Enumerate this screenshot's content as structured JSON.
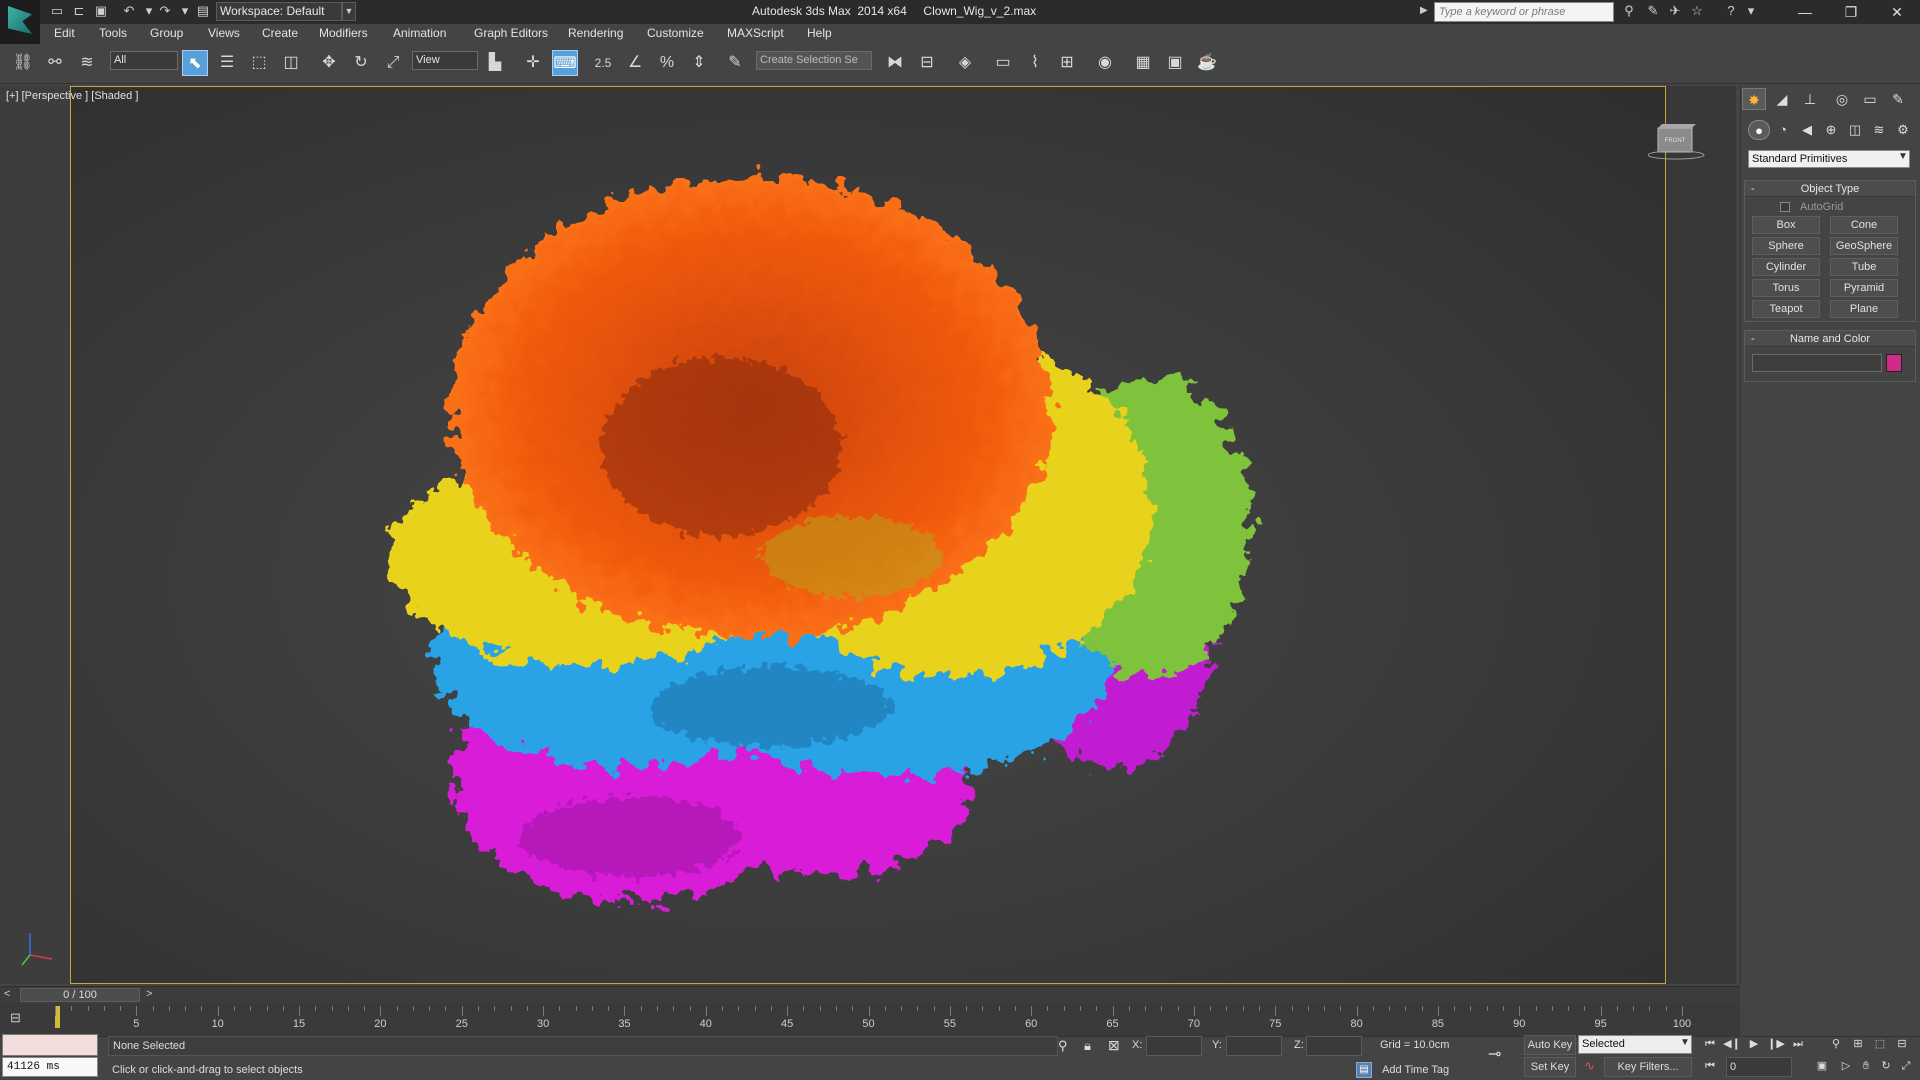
{
  "titlebar": {
    "workspace": "Workspace: Default",
    "app_title": "Autodesk 3ds Max  2014 x64     Clown_Wig_v_2.max",
    "search_placeholder": "Type a keyword or phrase"
  },
  "menu": [
    "Edit",
    "Tools",
    "Group",
    "Views",
    "Create",
    "Modifiers",
    "Animation",
    "Graph Editors",
    "Rendering",
    "Customize",
    "MAXScript",
    "Help"
  ],
  "toolbar": {
    "selection_filter": "All",
    "ref_coord_system": "View",
    "snap_angle_label": "2.5",
    "named_selection_placeholder": "Create Selection Se"
  },
  "viewport": {
    "label": "[+] [Perspective ] [Shaded ]",
    "viewcube_label": "FRONT",
    "hair_colors": [
      "#f05a0a",
      "#e8d21c",
      "#7fc23a",
      "#2aa2e6",
      "#d81fd8"
    ]
  },
  "command_panel": {
    "category": "Standard Primitives",
    "object_type_title": "Object Type",
    "autogrid_label": "AutoGrid",
    "primitives": [
      "Box",
      "Cone",
      "Sphere",
      "GeoSphere",
      "Cylinder",
      "Tube",
      "Torus",
      "Pyramid",
      "Teapot",
      "Plane"
    ],
    "name_color_title": "Name and Color",
    "object_color": "#d02a8a"
  },
  "timeline": {
    "position": "0 / 100",
    "ticks": [
      "5",
      "10",
      "15",
      "20",
      "25",
      "30",
      "35",
      "40",
      "45",
      "50",
      "55",
      "60",
      "65",
      "70",
      "75",
      "80",
      "85",
      "90",
      "95",
      "100"
    ]
  },
  "status": {
    "timing": "41126 ms",
    "selection": "None Selected",
    "prompt": "Click or click-and-drag to select objects",
    "x_label": "X:",
    "y_label": "Y:",
    "z_label": "Z:",
    "grid": "Grid = 10.0cm",
    "add_time_tag": "Add Time Tag",
    "auto_key": "Auto Key",
    "set_key": "Set Key",
    "key_mode": "Selected",
    "key_filters": "Key Filters...",
    "current_frame": "0"
  }
}
